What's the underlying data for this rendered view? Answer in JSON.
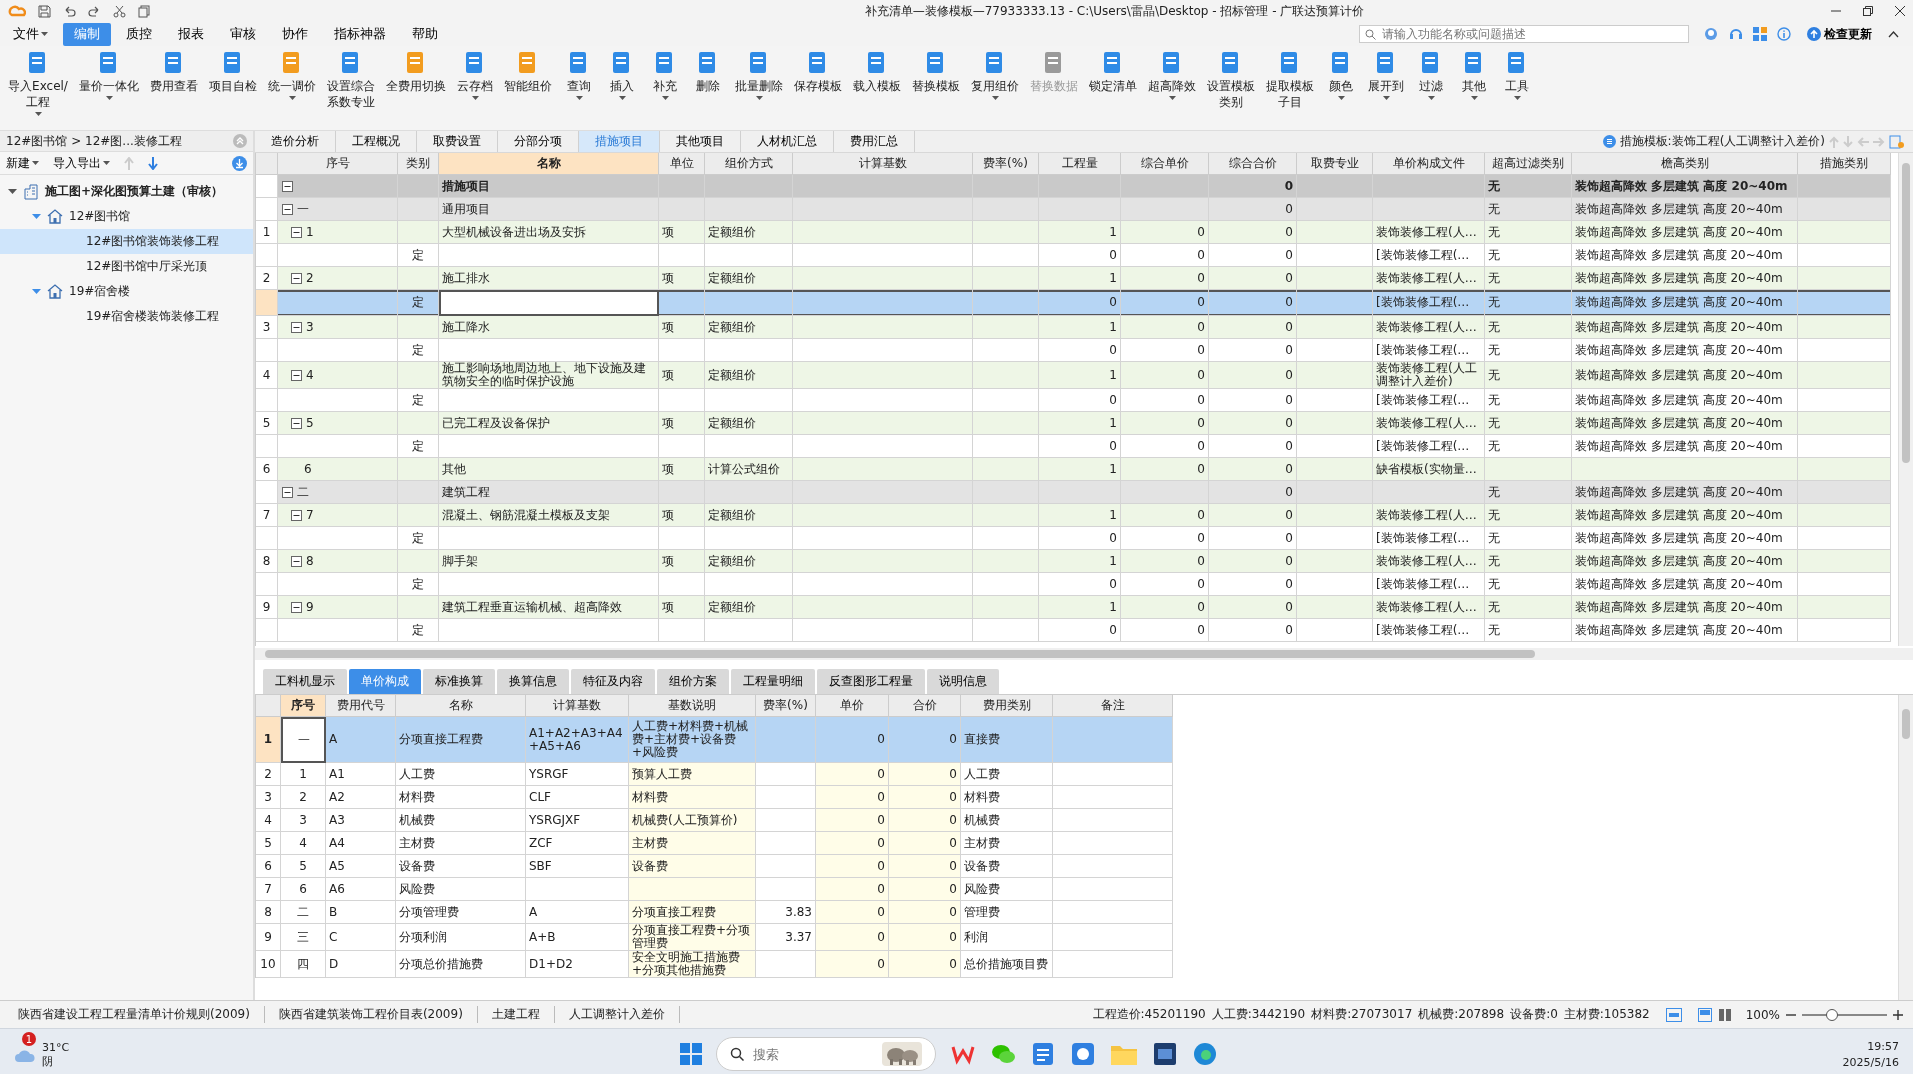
{
  "window": {
    "title": "补充清单—装修模板—77933333.13 - C:\\Users\\雷晶\\Desktop - 招标管理 - 广联达预算计价"
  },
  "menu": [
    {
      "label": "文件",
      "dropdown": true,
      "selected": false
    },
    {
      "label": "编制",
      "dropdown": false,
      "selected": true
    },
    {
      "label": "质控",
      "dropdown": false,
      "selected": false
    },
    {
      "label": "报表",
      "dropdown": false,
      "selected": false
    },
    {
      "label": "审核",
      "dropdown": false,
      "selected": false
    },
    {
      "label": "协作",
      "dropdown": false,
      "selected": false
    },
    {
      "label": "指标神器",
      "dropdown": false,
      "selected": false
    },
    {
      "label": "帮助",
      "dropdown": false,
      "selected": false
    }
  ],
  "search": {
    "placeholder": "请输入功能名称或问题描述"
  },
  "update_button": "检查更新",
  "toolbar": [
    {
      "label": "导入Excel/工程",
      "dropdown": true,
      "disabled": false,
      "color": "#2f8be6"
    },
    {
      "label": "量价一体化",
      "dropdown": true,
      "disabled": false,
      "color": "#2f8be6"
    },
    {
      "label": "费用查看",
      "dropdown": false,
      "disabled": false,
      "color": "#2f8be6"
    },
    {
      "label": "项目自检",
      "dropdown": false,
      "disabled": false,
      "color": "#2f8be6"
    },
    {
      "label": "统一调价",
      "dropdown": true,
      "disabled": false,
      "color": "#f29c1f"
    },
    {
      "label": "设置综合系数专业",
      "dropdown": false,
      "disabled": false,
      "color": "#2f8be6"
    },
    {
      "label": "全费用切换",
      "dropdown": false,
      "disabled": false,
      "color": "#f29c1f"
    },
    {
      "label": "云存档",
      "dropdown": true,
      "disabled": false,
      "color": "#2f8be6"
    },
    {
      "label": "智能组价",
      "dropdown": false,
      "disabled": false,
      "color": "#f29c1f"
    },
    {
      "label": "查询",
      "dropdown": true,
      "disabled": false,
      "color": "#2f8be6"
    },
    {
      "label": "插入",
      "dropdown": true,
      "disabled": false,
      "color": "#2f8be6"
    },
    {
      "label": "补充",
      "dropdown": true,
      "disabled": false,
      "color": "#2f8be6"
    },
    {
      "label": "删除",
      "dropdown": false,
      "disabled": false,
      "color": "#2f8be6"
    },
    {
      "label": "批量删除",
      "dropdown": true,
      "disabled": false,
      "color": "#2f8be6"
    },
    {
      "label": "保存模板",
      "dropdown": false,
      "disabled": false,
      "color": "#2f8be6"
    },
    {
      "label": "载入模板",
      "dropdown": false,
      "disabled": false,
      "color": "#2f8be6"
    },
    {
      "label": "替换模板",
      "dropdown": false,
      "disabled": false,
      "color": "#2f8be6"
    },
    {
      "label": "复用组价",
      "dropdown": true,
      "disabled": false,
      "color": "#2f8be6"
    },
    {
      "label": "替换数据",
      "dropdown": false,
      "disabled": true,
      "color": "#9a9a9a"
    },
    {
      "label": "锁定清单",
      "dropdown": false,
      "disabled": false,
      "color": "#2f8be6"
    },
    {
      "label": "超高降效",
      "dropdown": true,
      "disabled": false,
      "color": "#2f8be6"
    },
    {
      "label": "设置模板类别",
      "dropdown": false,
      "disabled": false,
      "color": "#2f8be6"
    },
    {
      "label": "提取模板子目",
      "dropdown": false,
      "disabled": false,
      "color": "#2f8be6"
    },
    {
      "label": "颜色",
      "dropdown": true,
      "disabled": false,
      "color": "#2f8be6"
    },
    {
      "label": "展开到",
      "dropdown": true,
      "disabled": false,
      "color": "#2f8be6"
    },
    {
      "label": "过滤",
      "dropdown": true,
      "disabled": false,
      "color": "#2f8be6"
    },
    {
      "label": "其他",
      "dropdown": true,
      "disabled": false,
      "color": "#2f8be6"
    },
    {
      "label": "工具",
      "dropdown": true,
      "disabled": false,
      "color": "#2f8be6"
    }
  ],
  "sidebar": {
    "breadcrumb": "12#图书馆 > 12#图...装修工程",
    "actions": [
      {
        "label": "新建"
      },
      {
        "label": "导入导出"
      }
    ],
    "tree": [
      {
        "label": "施工图+深化图预算土建（审核）",
        "expanded": true,
        "selected": false,
        "children": [
          {
            "label": "12#图书馆",
            "expanded": true,
            "selected": false,
            "children": [
              {
                "label": "12#图书馆装饰装修工程",
                "selected": true
              },
              {
                "label": "12#图书馆中厅采光顶",
                "selected": false
              }
            ]
          },
          {
            "label": "19#宿舍楼",
            "expanded": true,
            "selected": false,
            "children": [
              {
                "label": "19#宿舍楼装饰装修工程",
                "selected": false
              }
            ]
          }
        ]
      }
    ]
  },
  "tabs": [
    {
      "label": "造价分析",
      "selected": false
    },
    {
      "label": "工程概况",
      "selected": false
    },
    {
      "label": "取费设置",
      "selected": false
    },
    {
      "label": "分部分项",
      "selected": false
    },
    {
      "label": "措施项目",
      "selected": true
    },
    {
      "label": "其他项目",
      "selected": false
    },
    {
      "label": "人材机汇总",
      "selected": false
    },
    {
      "label": "费用汇总",
      "selected": false
    }
  ],
  "template_label": "措施模板:装饰工程(人工调整计入差价)",
  "table": {
    "columns": [
      {
        "label": "序号",
        "selected": false
      },
      {
        "label": "类别",
        "selected": false
      },
      {
        "label": "名称",
        "selected": true
      },
      {
        "label": "单位",
        "selected": false
      },
      {
        "label": "组价方式",
        "selected": false
      },
      {
        "label": "计算基数",
        "selected": false
      },
      {
        "label": "费率(%)",
        "selected": false
      },
      {
        "label": "工程量",
        "selected": false
      },
      {
        "label": "综合单价",
        "selected": false
      },
      {
        "label": "综合合价",
        "selected": false
      },
      {
        "label": "取费专业",
        "selected": false
      },
      {
        "label": "单价构成文件",
        "selected": false
      },
      {
        "label": "超高过滤类别",
        "selected": false
      },
      {
        "label": "檐高类别",
        "selected": false
      },
      {
        "label": "措施类别",
        "selected": false
      }
    ],
    "rows": [
      {
        "seq": "",
        "name": "措施项目",
        "total": "0",
        "filter": "无",
        "eave": "装饰超高降效 多层建筑 高度 20~40m",
        "expanded": true,
        "selected": false,
        "children": [
          {
            "seq": "一",
            "name": "通用项目",
            "total": "0",
            "filter": "无",
            "eave": "装饰超高降效 多层建筑 高度 20~40m",
            "expanded": true,
            "selected": false,
            "children": [
              {
                "index": "1",
                "seq": "1",
                "name": "大型机械设备进出场及安拆",
                "unit": "项",
                "method": "定额组价",
                "qty": "1",
                "unit_price": "0",
                "total": "0",
                "file": "装饰装修工程(人…",
                "filter": "无",
                "eave": "装饰超高降效 多层建筑 高度 20~40m",
                "expanded": true,
                "selected": false,
                "children": [
                  {
                    "type": "定",
                    "qty": "0",
                    "unit_price": "0",
                    "total": "0",
                    "file": "[装饰装修工程(…",
                    "filter": "无",
                    "eave": "装饰超高降效 多层建筑 高度 20~40m",
                    "selected": false
                  }
                ]
              },
              {
                "index": "2",
                "seq": "2",
                "name": "施工排水",
                "unit": "项",
                "method": "定额组价",
                "qty": "1",
                "unit_price": "0",
                "total": "0",
                "file": "装饰装修工程(人…",
                "filter": "无",
                "eave": "装饰超高降效 多层建筑 高度 20~40m",
                "expanded": true,
                "selected": false,
                "children": [
                  {
                    "type": "定",
                    "qty": "0",
                    "unit_price": "0",
                    "total": "0",
                    "file": "[装饰装修工程(…",
                    "filter": "无",
                    "eave": "装饰超高降效 多层建筑 高度 20~40m",
                    "selected": true
                  }
                ]
              },
              {
                "index": "3",
                "seq": "3",
                "name": "施工降水",
                "unit": "项",
                "method": "定额组价",
                "qty": "1",
                "unit_price": "0",
                "total": "0",
                "file": "装饰装修工程(人…",
                "filter": "无",
                "eave": "装饰超高降效 多层建筑 高度 20~40m",
                "expanded": true,
                "selected": false,
                "children": [
                  {
                    "type": "定",
                    "qty": "0",
                    "unit_price": "0",
                    "total": "0",
                    "file": "[装饰装修工程(…",
                    "filter": "无",
                    "eave": "装饰超高降效 多层建筑 高度 20~40m",
                    "selected": false
                  }
                ]
              },
              {
                "index": "4",
                "seq": "4",
                "name": "施工影响场地周边地上、地下设施及建筑物安全的临时保护设施",
                "unit": "项",
                "method": "定额组价",
                "qty": "1",
                "unit_price": "0",
                "total": "0",
                "file": "装饰装修工程(人工调整计入差价)",
                "filter": "无",
                "eave": "装饰超高降效 多层建筑 高度 20~40m",
                "expanded": true,
                "selected": false,
                "children": [
                  {
                    "type": "定",
                    "qty": "0",
                    "unit_price": "0",
                    "total": "0",
                    "file": "[装饰装修工程(…",
                    "filter": "无",
                    "eave": "装饰超高降效 多层建筑 高度 20~40m",
                    "selected": false
                  }
                ]
              },
              {
                "index": "5",
                "seq": "5",
                "name": "已完工程及设备保护",
                "unit": "项",
                "method": "定额组价",
                "qty": "1",
                "unit_price": "0",
                "total": "0",
                "file": "装饰装修工程(人…",
                "filter": "无",
                "eave": "装饰超高降效 多层建筑 高度 20~40m",
                "expanded": true,
                "selected": false,
                "children": [
                  {
                    "type": "定",
                    "qty": "0",
                    "unit_price": "0",
                    "total": "0",
                    "file": "[装饰装修工程(…",
                    "filter": "无",
                    "eave": "装饰超高降效 多层建筑 高度 20~40m",
                    "selected": false
                  }
                ]
              },
              {
                "index": "6",
                "seq": "6",
                "name": "其他",
                "unit": "项",
                "method": "计算公式组价",
                "qty": "1",
                "unit_price": "0",
                "total": "0",
                "file": "缺省模板(实物量…",
                "selected": false
              }
            ]
          },
          {
            "seq": "二",
            "name": "建筑工程",
            "total": "0",
            "filter": "无",
            "eave": "装饰超高降效 多层建筑 高度 20~40m",
            "expanded": true,
            "selected": false,
            "children": [
              {
                "index": "7",
                "seq": "7",
                "name": "混凝土、钢筋混凝土模板及支架",
                "unit": "项",
                "method": "定额组价",
                "qty": "1",
                "unit_price": "0",
                "total": "0",
                "file": "装饰装修工程(人…",
                "filter": "无",
                "eave": "装饰超高降效 多层建筑 高度 20~40m",
                "expanded": true,
                "selected": false,
                "children": [
                  {
                    "type": "定",
                    "qty": "0",
                    "unit_price": "0",
                    "total": "0",
                    "file": "[装饰装修工程(…",
                    "filter": "无",
                    "eave": "装饰超高降效 多层建筑 高度 20~40m",
                    "selected": false
                  }
                ]
              },
              {
                "index": "8",
                "seq": "8",
                "name": "脚手架",
                "unit": "项",
                "method": "定额组价",
                "qty": "1",
                "unit_price": "0",
                "total": "0",
                "file": "装饰装修工程(人…",
                "filter": "无",
                "eave": "装饰超高降效 多层建筑 高度 20~40m",
                "expanded": true,
                "selected": false,
                "children": [
                  {
                    "type": "定",
                    "qty": "0",
                    "unit_price": "0",
                    "total": "0",
                    "file": "[装饰装修工程(…",
                    "filter": "无",
                    "eave": "装饰超高降效 多层建筑 高度 20~40m",
                    "selected": false
                  }
                ]
              },
              {
                "index": "9",
                "seq": "9",
                "name": "建筑工程垂直运输机械、超高降效",
                "unit": "项",
                "method": "定额组价",
                "qty": "1",
                "unit_price": "0",
                "total": "0",
                "file": "装饰装修工程(人…",
                "filter": "无",
                "eave": "装饰超高降效 多层建筑 高度 20~40m",
                "expanded": true,
                "selected": false,
                "children": [
                  {
                    "type": "定",
                    "qty": "0",
                    "unit_price": "0",
                    "total": "0",
                    "file": "[装饰装修工程(…",
                    "filter": "无",
                    "eave": "装饰超高降效 多层建筑 高度 20~40m",
                    "selected": false
                  }
                ]
              }
            ]
          }
        ]
      }
    ]
  },
  "detail_tabs": [
    {
      "label": "工料机显示",
      "selected": false
    },
    {
      "label": "单价构成",
      "selected": true
    },
    {
      "label": "标准换算",
      "selected": false
    },
    {
      "label": "换算信息",
      "selected": false
    },
    {
      "label": "特征及内容",
      "selected": false
    },
    {
      "label": "组价方案",
      "selected": false
    },
    {
      "label": "工程量明细",
      "selected": false
    },
    {
      "label": "反查图形工程量",
      "selected": false
    },
    {
      "label": "说明信息",
      "selected": false
    }
  ],
  "detail_table": {
    "columns": [
      {
        "label": "序号",
        "selected": true
      },
      {
        "label": "费用代号",
        "selected": false
      },
      {
        "label": "名称",
        "selected": false
      },
      {
        "label": "计算基数",
        "selected": false
      },
      {
        "label": "基数说明",
        "selected": false
      },
      {
        "label": "费率(%)",
        "selected": false
      },
      {
        "label": "单价",
        "selected": false
      },
      {
        "label": "合价",
        "selected": false
      },
      {
        "label": "费用类别",
        "selected": false
      },
      {
        "label": "备注",
        "selected": false
      }
    ],
    "rows": [
      {
        "index": "1",
        "seq": "一",
        "code": "A",
        "name": "分项直接工程费",
        "base": "A1+A2+A3+A4+A5+A6",
        "desc": "人工费+材料费+机械费+主材费+设备费+风险费",
        "unit_price": "0",
        "total": "0",
        "category": "直接费",
        "selected": true
      },
      {
        "index": "2",
        "seq": "1",
        "code": "A1",
        "name": "人工费",
        "base": "YSRGF",
        "desc": "预算人工费",
        "unit_price": "0",
        "total": "0",
        "category": "人工费",
        "selected": false
      },
      {
        "index": "3",
        "seq": "2",
        "code": "A2",
        "name": "材料费",
        "base": "CLF",
        "desc": "材料费",
        "unit_price": "0",
        "total": "0",
        "category": "材料费",
        "selected": false
      },
      {
        "index": "4",
        "seq": "3",
        "code": "A3",
        "name": "机械费",
        "base": "YSRGJXF",
        "desc": "机械费(人工预算价)",
        "unit_price": "0",
        "total": "0",
        "category": "机械费",
        "selected": false
      },
      {
        "index": "5",
        "seq": "4",
        "code": "A4",
        "name": "主材费",
        "base": "ZCF",
        "desc": "主材费",
        "unit_price": "0",
        "total": "0",
        "category": "主材费",
        "selected": false
      },
      {
        "index": "6",
        "seq": "5",
        "code": "A5",
        "name": "设备费",
        "base": "SBF",
        "desc": "设备费",
        "unit_price": "0",
        "total": "0",
        "category": "设备费",
        "selected": false
      },
      {
        "index": "7",
        "seq": "6",
        "code": "A6",
        "name": "风险费",
        "unit_price": "0",
        "total": "0",
        "category": "风险费",
        "selected": false
      },
      {
        "index": "8",
        "seq": "二",
        "code": "B",
        "name": "分项管理费",
        "base": "A",
        "desc": "分项直接工程费",
        "rate": "3.83",
        "unit_price": "0",
        "total": "0",
        "category": "管理费",
        "selected": false
      },
      {
        "index": "9",
        "seq": "三",
        "code": "C",
        "name": "分项利润",
        "base": "A+B",
        "desc": "分项直接工程费+分项管理费",
        "rate": "3.37",
        "unit_price": "0",
        "total": "0",
        "category": "利润",
        "selected": false
      },
      {
        "index": "10",
        "seq": "四",
        "code": "D",
        "name": "分项总价措施费",
        "base": "D1+D2",
        "desc": "安全文明施工措施费+分项其他措施费",
        "unit_price": "0",
        "total": "0",
        "category": "总价措施项目费",
        "selected": false
      }
    ]
  },
  "status_bar": {
    "segments": [
      "陕西省建设工程工程量清单计价规则(2009)",
      "陕西省建筑装饰工程价目表(2009)",
      "土建工程",
      "人工调整计入差价"
    ],
    "totals": [
      "工程造价:45201190",
      "人工费:3442190",
      "材料费:27073017",
      "机械费:207898",
      "设备费:0",
      "主材费:105382"
    ],
    "zoom": {
      "reading": "100%",
      "level": 0.35
    }
  },
  "taskbar": {
    "weather": {
      "temperature": "31°C",
      "condition": "阴",
      "badge": "1"
    },
    "search": {
      "placeholder": "搜索"
    },
    "time": "19:57",
    "date": "2025/5/16"
  }
}
